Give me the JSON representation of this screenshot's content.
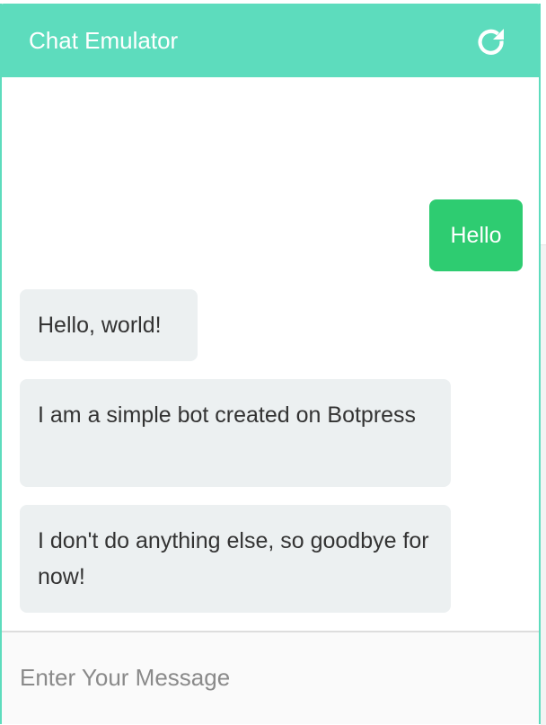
{
  "header": {
    "title": "Chat Emulator",
    "refresh_icon": "refresh-icon"
  },
  "messages": [
    {
      "sender": "user",
      "text": "Hello"
    },
    {
      "sender": "bot",
      "text": "Hello, world!"
    },
    {
      "sender": "bot",
      "text": "I am a simple bot created on Botpress"
    },
    {
      "sender": "bot",
      "text": "I don't do anything else, so goodbye for now!"
    }
  ],
  "composer": {
    "placeholder": "Enter Your Message",
    "value": ""
  },
  "colors": {
    "header_bg": "#5ddcbd",
    "user_bubble": "#2ecc71",
    "bot_bubble": "#ecf0f1",
    "bot_text": "#333333"
  }
}
